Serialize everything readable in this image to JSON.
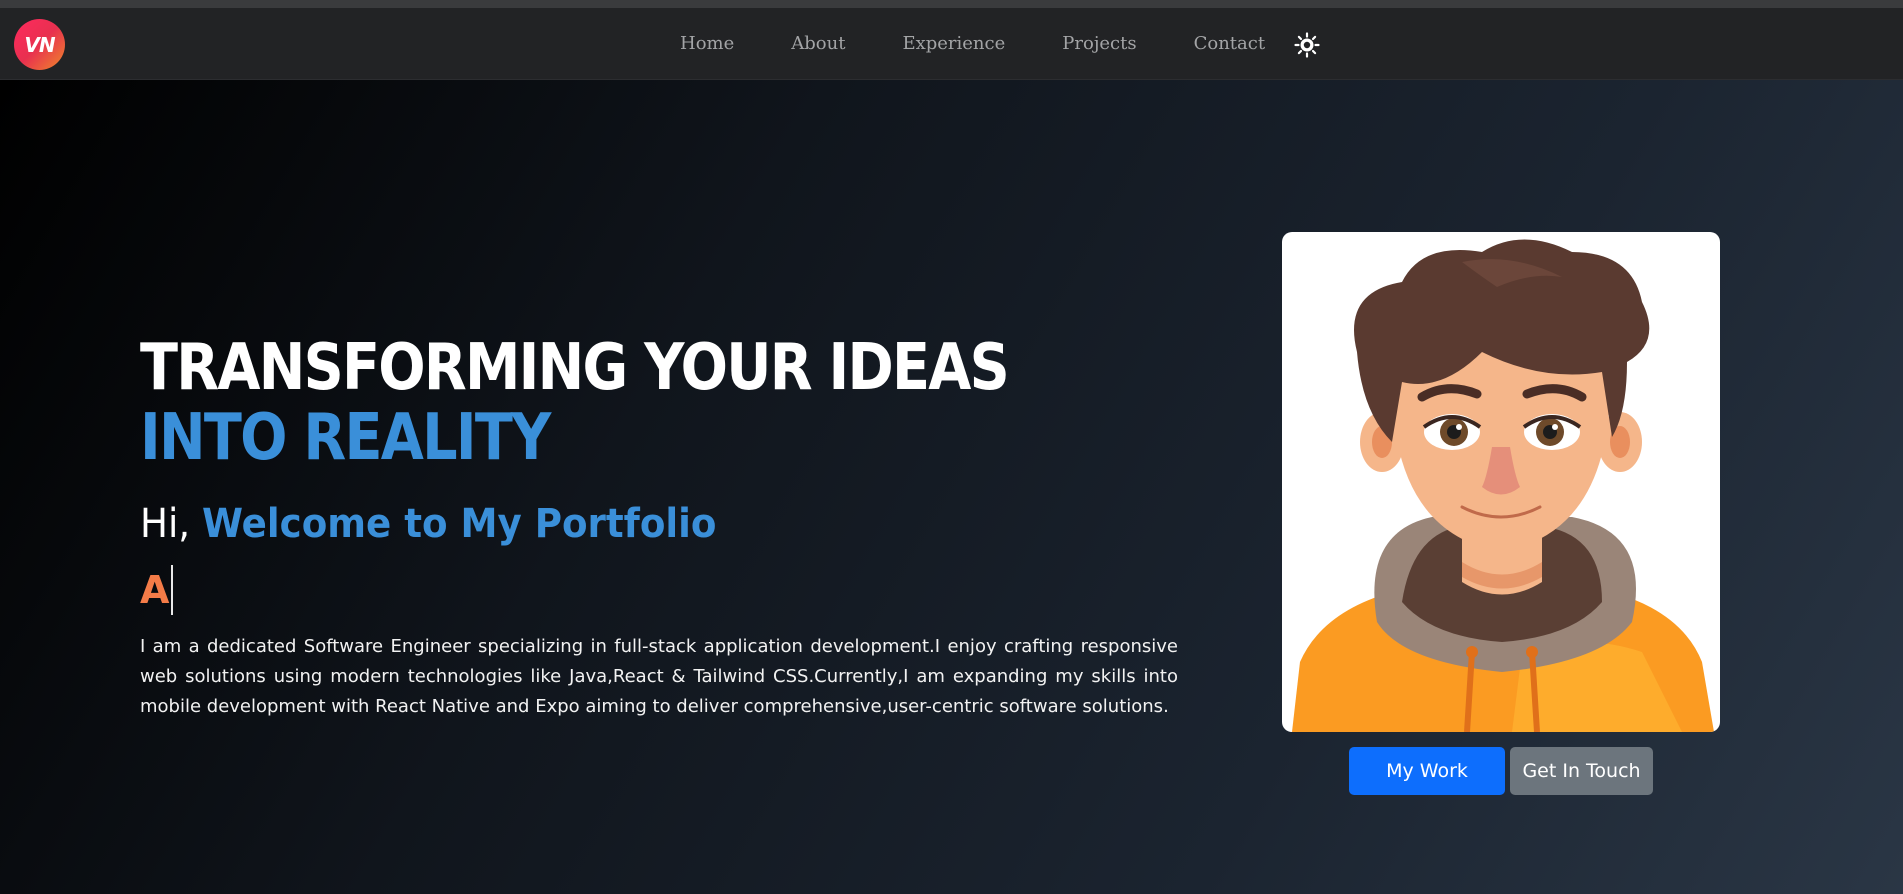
{
  "brand": {
    "logo_text": "VN"
  },
  "nav": {
    "items": [
      {
        "label": "Home"
      },
      {
        "label": "About"
      },
      {
        "label": "Experience"
      },
      {
        "label": "Projects"
      },
      {
        "label": "Contact"
      }
    ],
    "theme_toggle_icon": "sun-icon"
  },
  "hero": {
    "headline_line1": "TRANSFORMING YOUR IDEAS",
    "headline_line2": "INTO REALITY",
    "greeting_prefix": "Hi,",
    "greeting_highlight": "Welcome to My Portfolio",
    "typed_text": "A",
    "bio": "I am a dedicated Software Engineer specializing in full-stack application development.I enjoy crafting responsive web solutions using modern technologies like Java,React & Tailwind CSS.Currently,I am expanding my skills into mobile development with React Native and Expo aiming to deliver comprehensive,user-centric software solutions.",
    "buttons": {
      "primary_label": "My Work",
      "secondary_label": "Get In Touch"
    }
  },
  "colors": {
    "accent_blue": "#3a8fd9",
    "accent_orange": "#f47c48",
    "button_primary": "#0d6efd",
    "button_secondary": "#6c757d",
    "navbar_bg": "#222325"
  }
}
